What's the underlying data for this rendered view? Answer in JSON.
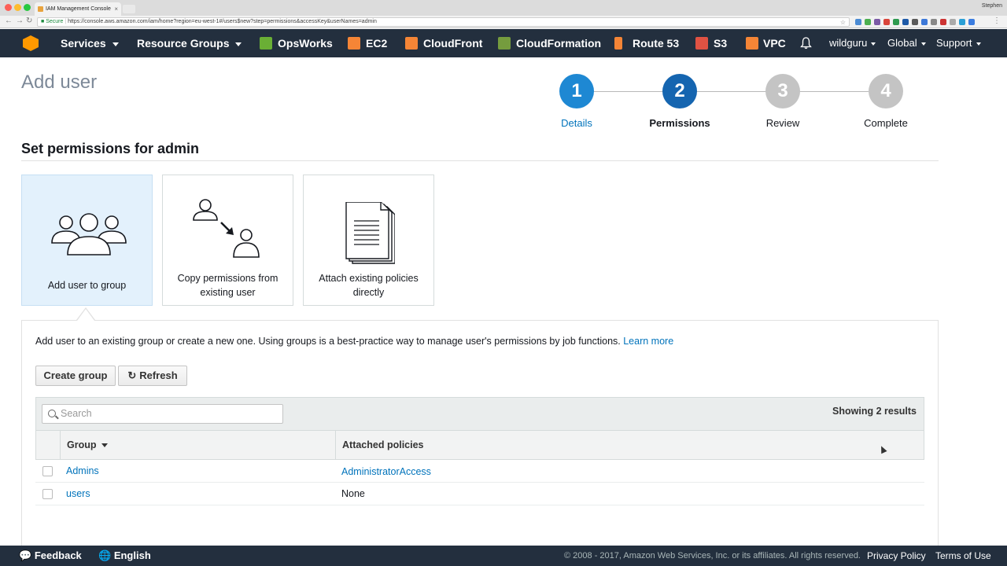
{
  "browser": {
    "tab_title": "IAM Management Console",
    "profile_name": "Stephen",
    "secure_label": "Secure",
    "url": "https://console.aws.amazon.com/iam/home?region=eu-west-1#/users$new?step=permissions&accessKey&userNames=admin"
  },
  "navbar": {
    "services": "Services",
    "resource_groups": "Resource Groups",
    "shortcuts": [
      {
        "label": "OpsWorks",
        "icon": "opsworks-icon",
        "color": "#6aaf35"
      },
      {
        "label": "EC2",
        "icon": "ec2-icon",
        "color": "#f58536"
      },
      {
        "label": "CloudFront",
        "icon": "cloudfront-icon",
        "color": "#f58536"
      },
      {
        "label": "CloudFormation",
        "icon": "cloudformation-icon",
        "color": "#759c3e"
      },
      {
        "label": "Route 53",
        "icon": "route53-icon",
        "color": "#f58536"
      },
      {
        "label": "S3",
        "icon": "s3-icon",
        "color": "#e05243"
      },
      {
        "label": "VPC",
        "icon": "vpc-icon",
        "color": "#f58536"
      }
    ],
    "account": "wildguru",
    "region": "Global",
    "support": "Support"
  },
  "page": {
    "title": "Add user",
    "section_title": "Set permissions for admin"
  },
  "steps": [
    {
      "number": "1",
      "label": "Details",
      "state": "done"
    },
    {
      "number": "2",
      "label": "Permissions",
      "state": "current"
    },
    {
      "number": "3",
      "label": "Review",
      "state": "pending"
    },
    {
      "number": "4",
      "label": "Complete",
      "state": "pending"
    }
  ],
  "options": {
    "add_to_group": "Add user to group",
    "copy_permissions_line1": "Copy permissions from",
    "copy_permissions_line2": "existing user",
    "attach_policies_line1": "Attach existing policies",
    "attach_policies_line2": "directly"
  },
  "panel": {
    "description": "Add user to an existing group or create a new one. Using groups is a best-practice way to manage user's permissions by job functions.",
    "learn_more": "Learn more",
    "create_group": "Create group",
    "refresh": "Refresh",
    "search_placeholder": "Search",
    "showing": "Showing 2 results"
  },
  "table": {
    "columns": [
      "Group",
      "Attached policies"
    ],
    "rows": [
      {
        "group": "Admins",
        "policies": "AdministratorAccess"
      },
      {
        "group": "users",
        "policies": "None"
      }
    ]
  },
  "footer": {
    "feedback": "Feedback",
    "language": "English",
    "copyright": "© 2008 - 2017, Amazon Web Services, Inc. or its affiliates. All rights reserved.",
    "privacy": "Privacy Policy",
    "terms": "Terms of Use"
  },
  "colors": {
    "step_done": "#1e88d3",
    "step_current": "#1565b0",
    "step_pending": "#c4c4c4",
    "link": "#0073bb",
    "navbar_bg": "#232f3e"
  }
}
